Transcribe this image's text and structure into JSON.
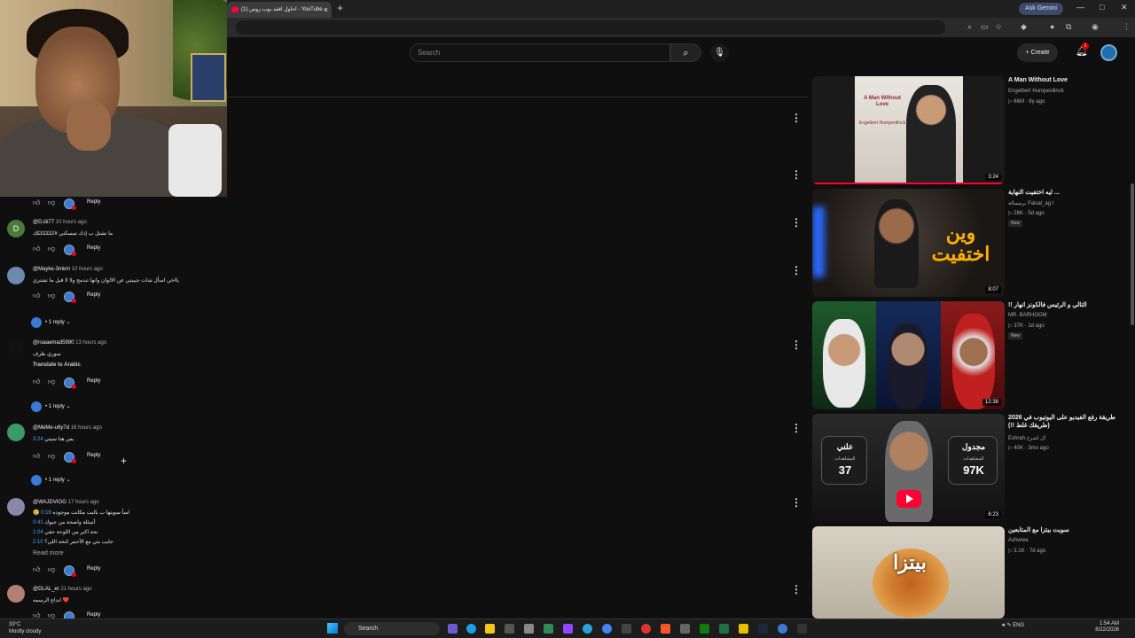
{
  "browser": {
    "tab_title": "(1) احاول افقد بوب روس - YouTube",
    "ask_gemini": "Ask Gemini"
  },
  "youtube": {
    "search_placeholder": "Search",
    "create_label": "Create",
    "notification_count": "1"
  },
  "comments": [
    {
      "author": "@D.iiii77",
      "time": "10 hours ago",
      "avatar_letter": "D",
      "avatar_color": "#4a7a3a",
      "lines": [
        "ما تشتل ب إذك تمسكني #ككككككك"
      ],
      "reply": "Reply"
    },
    {
      "author": "@Mayke-3mkm",
      "time": "10 hours ago",
      "avatar_letter": "",
      "avatar_color": "#6a8ab0",
      "lines": [
        "يااخي اسأل شات جيبيتي عن الالوان وانها تندمج ولا لا قبل ما تشتري"
      ],
      "reply": "Reply",
      "replies_label": "1 reply"
    },
    {
      "author": "@roaaemad5990",
      "time": "13 hours ago",
      "avatar_letter": "",
      "avatar_color": "#111111",
      "lines": [
        "سوري ظرف"
      ],
      "translate": "Translate to Arabic",
      "reply": "Reply",
      "replies_label": "1 reply"
    },
    {
      "author": "@MeMe-u6y7d",
      "time": "16 hours ago",
      "avatar_letter": "",
      "avatar_color": "#3a9a6a",
      "lines": [
        "يس هنا سيتي"
      ],
      "timestamp": "3:24",
      "reply": "Reply",
      "replies_label": "1 reply"
    },
    {
      "author": "@WAJDVIOG",
      "time": "17 hours ago",
      "avatar_letter": "",
      "avatar_color": "#8888aa",
      "lines": [
        "😢 اسأ سويتها ب بالبت مكانت موجوده",
        "أسئلة واضحة من جيوك",
        "نحة اكبر من اللوحة حقي",
        "جايب بتي مع الأحمر كنخه اللي؟"
      ],
      "links": [
        "0:16",
        "0:41",
        "1:04",
        "2:10"
      ],
      "read_more": "Read more",
      "reply": "Reply"
    },
    {
      "author": "@DLAL_er",
      "time": "21 hours ago",
      "avatar_letter": "",
      "avatar_color": "#b08070",
      "lines": [
        "ابداع الرسمه ❤️"
      ],
      "reply": "Reply"
    }
  ],
  "recommendations": [
    {
      "title": "A Man Without Love",
      "channel": "Engelbert Humperdinck",
      "views": "66M",
      "age": "8y ago",
      "duration": "3:24",
      "badge": "",
      "thumb_title": "A Man Without Love",
      "thumb_artist": "Engelbert Humperdinck"
    },
    {
      "title": "ليه اختفيت النهاية ...",
      "channel": "برمسالة Faisal_ag I",
      "views": "26K",
      "age": "5d ago",
      "duration": "8:07",
      "badge": "New",
      "thumb_text": "وين اختفيت"
    },
    {
      "title": "!! التالي و الرئيس فالكونز انهار",
      "channel": "MR. BARHOOM",
      "views": "37K",
      "age": "1d ago",
      "duration": "12:38",
      "badge": "New"
    },
    {
      "title": "طريقة رفع الفيديو على اليوتيوب في 2026 (طريقك غلط !!)",
      "channel": "Eshrah ال اشرح",
      "views": "40K",
      "age": "3mo ago",
      "duration": "6:23",
      "badge": "",
      "stat_left_label": "علني",
      "stat_left_value": "37",
      "stat_right_label": "مجدول",
      "stat_right_value": "97K",
      "stat_sub": "المشاهدات"
    },
    {
      "title": "سويت بيتزا مع المتابعين",
      "channel": "Ashwwa",
      "views": "3.1K",
      "age": "7d ago",
      "duration": "",
      "badge": "",
      "thumb_text": "بيتزا"
    }
  ],
  "taskbar": {
    "temp": "33°C",
    "weather": "Mostly cloudy",
    "search": "Search",
    "lang": "ENG",
    "time": "1:54 AM",
    "date": "8/22/2026"
  },
  "colors": {
    "accent_blue": "#3ea6ff",
    "youtube_red": "#ff0033",
    "background": "#0f0f0f"
  }
}
